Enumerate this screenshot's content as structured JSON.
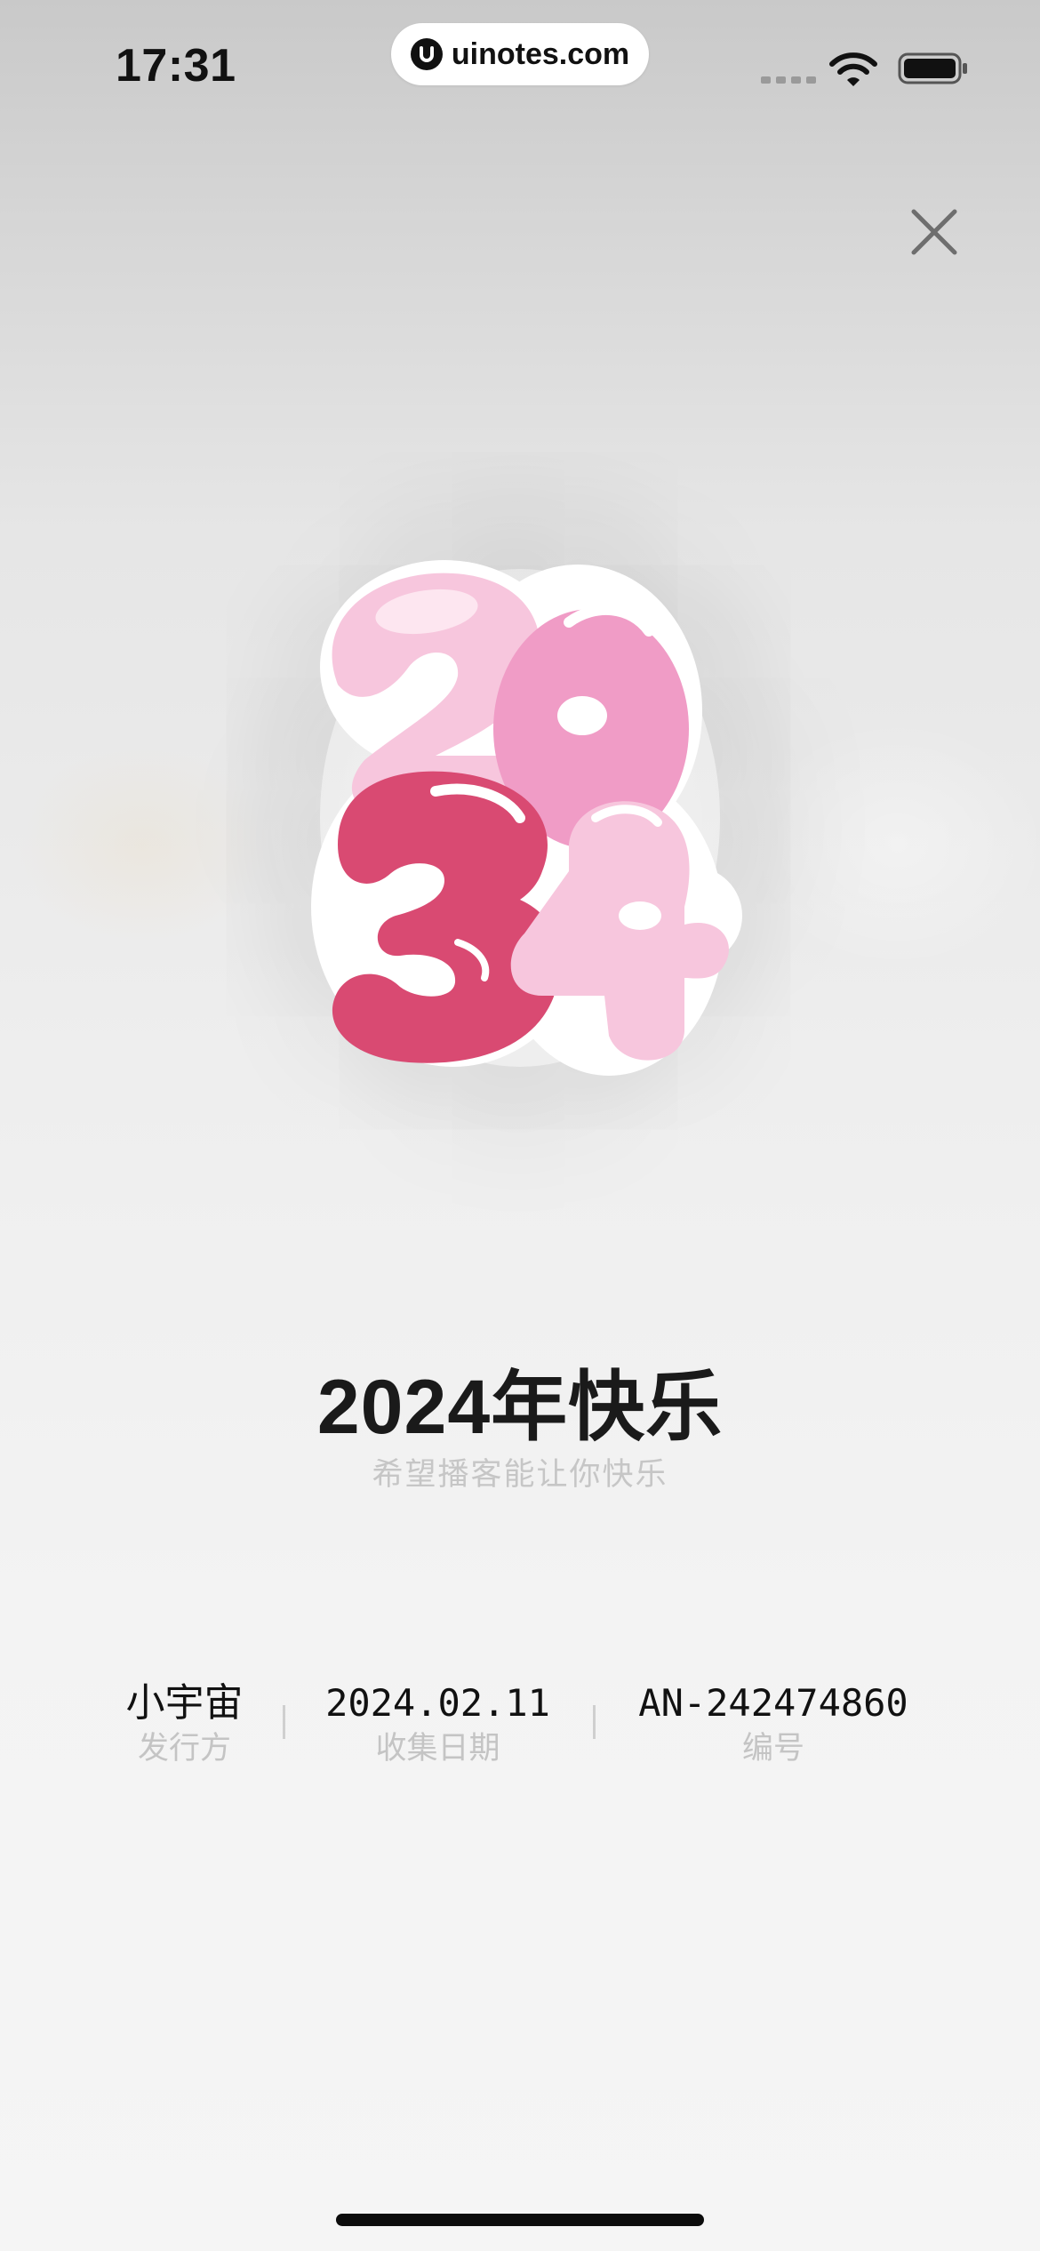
{
  "status_bar": {
    "time": "17:31",
    "url": "uinotes.com"
  },
  "icons": {
    "close": "close-icon",
    "wifi": "wifi-icon",
    "battery": "battery-icon",
    "signal": "signal-icon"
  },
  "sticker": {
    "text": "2024",
    "colors": {
      "light_pink": "#f7c6dd",
      "mid_pink": "#f09cc6",
      "deep_pink": "#d94a72",
      "outline": "#ffffff"
    }
  },
  "card": {
    "title": "2024年快乐",
    "subtitle": "希望播客能让你快乐"
  },
  "info": {
    "publisher_value": "小宇宙",
    "publisher_label": "发行方",
    "date_value": "2024.02.11",
    "date_label": "收集日期",
    "id_value": "AN-242474860",
    "id_label": "编号"
  }
}
